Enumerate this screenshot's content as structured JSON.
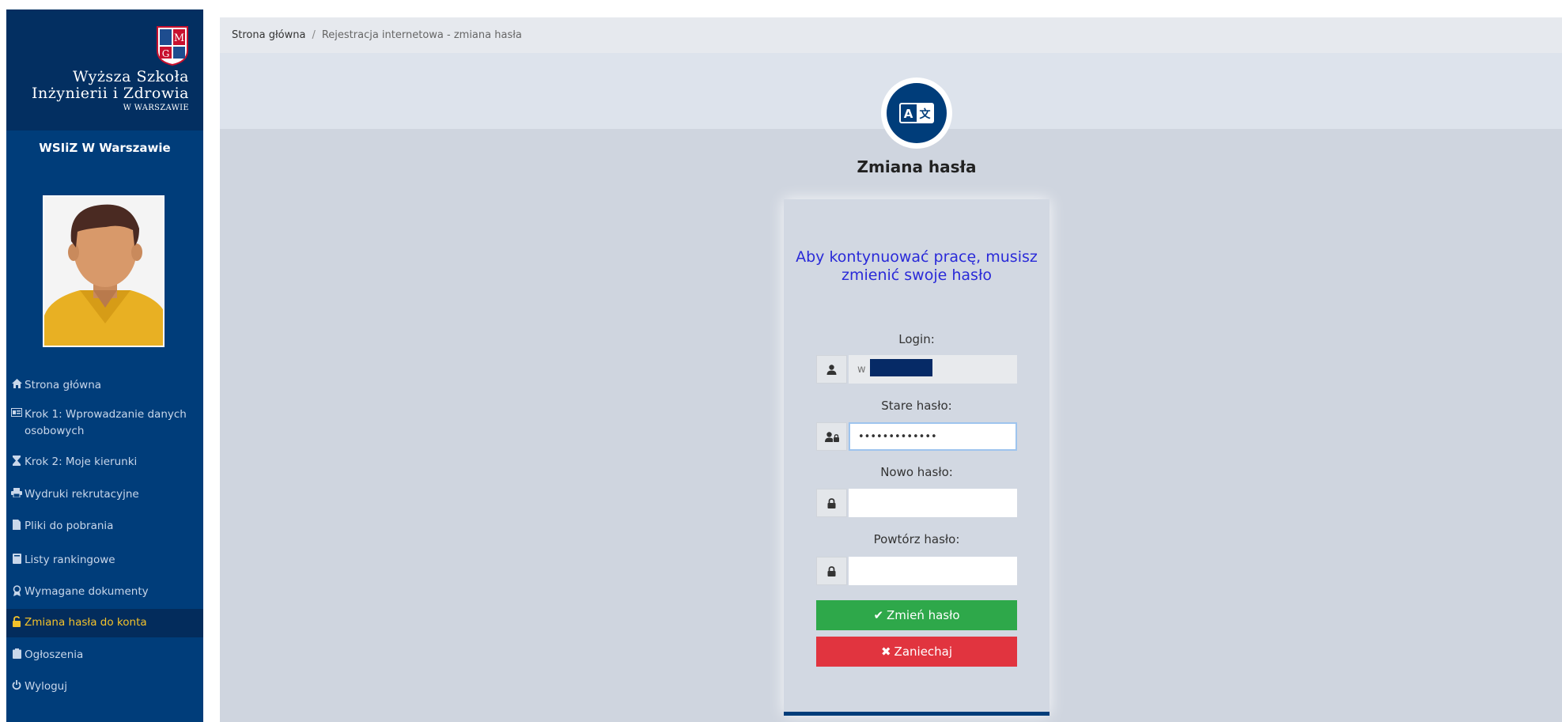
{
  "sidebar": {
    "logo": {
      "crest_letters": [
        "M",
        "G"
      ],
      "line1": "Wyższa Szkoła",
      "line2": "Inżynierii i Zdrowia",
      "line3": "W WARSZAWIE"
    },
    "school_short": "WSIiZ W Warszawie",
    "nav": [
      {
        "label": "Strona główna",
        "icon": "home-icon",
        "active": false
      },
      {
        "label": "Krok 1: Wprowadzanie danych osobowych",
        "icon": "id-card-icon",
        "active": false
      },
      {
        "label": "Krok 2: Moje kierunki",
        "icon": "hourglass-icon",
        "active": false
      },
      {
        "label": "Wydruki rekrutacyjne",
        "icon": "printer-icon",
        "active": false
      },
      {
        "label": "Pliki do pobrania",
        "icon": "file-icon",
        "active": false
      },
      {
        "label": "Listy rankingowe",
        "icon": "book-icon",
        "active": false
      },
      {
        "label": "Wymagane dokumenty",
        "icon": "award-icon",
        "active": false
      },
      {
        "label": "Zmiana hasła do konta",
        "icon": "unlock-icon",
        "active": true
      },
      {
        "label": "Ogłoszenia",
        "icon": "clipboard-icon",
        "active": false
      },
      {
        "label": "Wyloguj",
        "icon": "power-icon",
        "active": false
      }
    ]
  },
  "breadcrumb": {
    "home": "Strona główna",
    "separator": "/",
    "current": "Rejestracja internetowa - zmiana hasła"
  },
  "page": {
    "icon": "language-icon",
    "icon_glyphs": [
      "A",
      "文"
    ],
    "title": "Zmiana hasła"
  },
  "form": {
    "notice": "Aby kontynuować pracę, musisz zmienić swoje hasło",
    "login_label": "Login:",
    "login_value": "w",
    "old_password_label": "Stare hasło:",
    "old_password_value": "•••••••••••••",
    "new_password_label": "Nowo hasło:",
    "new_password_value": "",
    "repeat_password_label": "Powtórz hasło:",
    "repeat_password_value": "",
    "submit_label": "Zmień hasło",
    "cancel_label": "Zaniechaj"
  },
  "colors": {
    "sidebar_bg": "#003d7a",
    "logo_bg": "#032f61",
    "active_text": "#f3c22b",
    "notice_text": "#2a2ad8",
    "success": "#2ea84a",
    "danger": "#e1343f"
  }
}
